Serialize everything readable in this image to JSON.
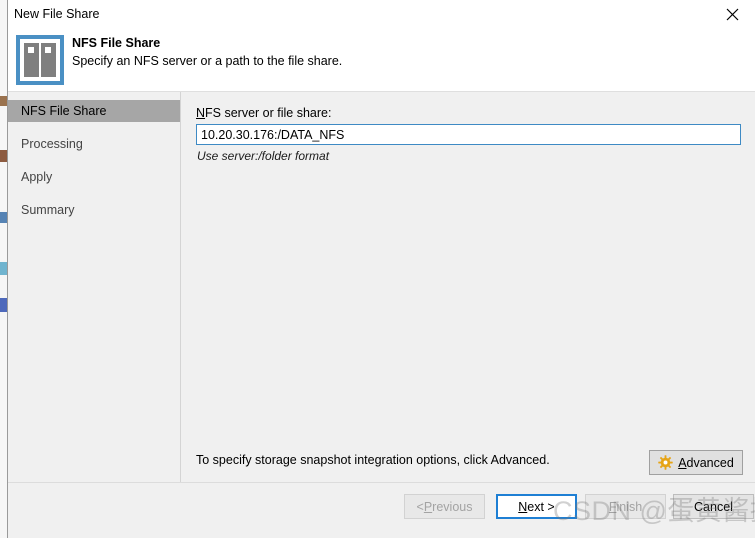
{
  "window": {
    "title": "New File Share",
    "close_icon": "close-icon"
  },
  "header": {
    "icon": "file-share-icon",
    "title": "NFS File Share",
    "subtitle": "Specify an NFS server or a path to the file share."
  },
  "sidebar": {
    "items": [
      {
        "label": "NFS File Share",
        "active": true
      },
      {
        "label": "Processing",
        "active": false
      },
      {
        "label": "Apply",
        "active": false
      },
      {
        "label": "Summary",
        "active": false
      }
    ]
  },
  "main": {
    "field_label_accesskey": "N",
    "field_label_rest": "FS server or file share:",
    "field_value": "10.20.30.176:/DATA_NFS",
    "field_placeholder": "server:/folder",
    "field_hint": "Use server:/folder format",
    "advanced_note": "To specify storage snapshot integration options, click Advanced.",
    "advanced_accesskey": "A",
    "advanced_rest": "dvanced",
    "advanced_icon": "gear-icon"
  },
  "footer": {
    "previous": {
      "prefix": "< ",
      "accesskey": "P",
      "rest": "revious",
      "disabled": true
    },
    "next": {
      "accesskey": "N",
      "rest": "ext >",
      "disabled": false,
      "focused": true
    },
    "finish": {
      "accesskey": "F",
      "rest": "inish",
      "disabled": true
    },
    "cancel": {
      "label": "Cancel",
      "disabled": false
    }
  },
  "watermark": {
    "latin": "CSDN @",
    "cjk": "蛋黄酱拌饭"
  },
  "colors": {
    "accent": "#1e7fd4",
    "icon_border": "#4a90c4",
    "icon_panel": "#7f7f7f",
    "gear": "#e6a416",
    "nav_active_bg": "#a6a6a6",
    "surface": "#f0f0f0",
    "header_bg": "#ffffff"
  }
}
